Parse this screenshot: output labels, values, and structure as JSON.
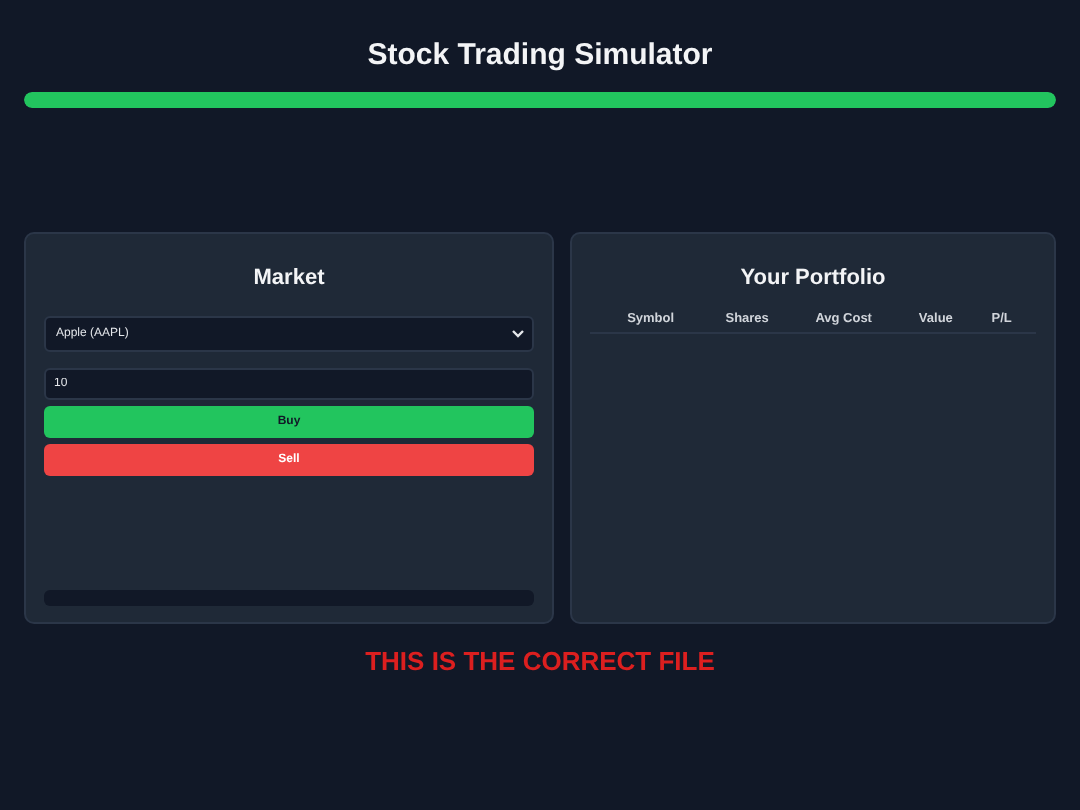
{
  "title": "Stock Trading Simulator",
  "progress": {
    "level": 1
  },
  "market": {
    "title": "Market",
    "stock_select": {
      "value": "Apple (AAPL)"
    },
    "quantity": {
      "value": "10"
    },
    "buttons": [
      {
        "label": "Buy",
        "kind": "buy"
      },
      {
        "label": "Sell",
        "kind": "sell"
      }
    ]
  },
  "portfolio": {
    "title": "Your Portfolio",
    "columns": [
      "Symbol",
      "Shares",
      "Avg Cost",
      "Value",
      "P/L"
    ]
  },
  "notice": "THIS IS THE CORRECT FILE"
}
